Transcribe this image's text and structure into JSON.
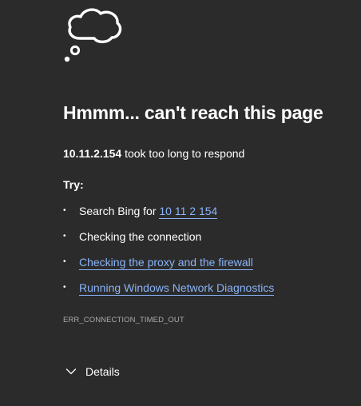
{
  "error_page": {
    "title": "Hmmm... can't reach this page",
    "host": "10.11.2.154",
    "host_message": " took too long to respond",
    "try_label": "Try:",
    "suggestions": [
      {
        "prefix": "Search Bing for ",
        "link": "10 11 2 154"
      },
      {
        "text": "Checking the connection"
      },
      {
        "link": "Checking the proxy and the firewall"
      },
      {
        "link": "Running Windows Network Diagnostics"
      }
    ],
    "error_code": "ERR_CONNECTION_TIMED_OUT",
    "details_label": "Details"
  },
  "icons": {
    "illustration": "thought-cloud-icon",
    "details_toggle": "chevron-down-icon",
    "bullet": "•"
  },
  "colors": {
    "background": "#2b2b2b",
    "text": "#ffffff",
    "link": "#8ab4f8",
    "muted": "#aaaaaa"
  }
}
